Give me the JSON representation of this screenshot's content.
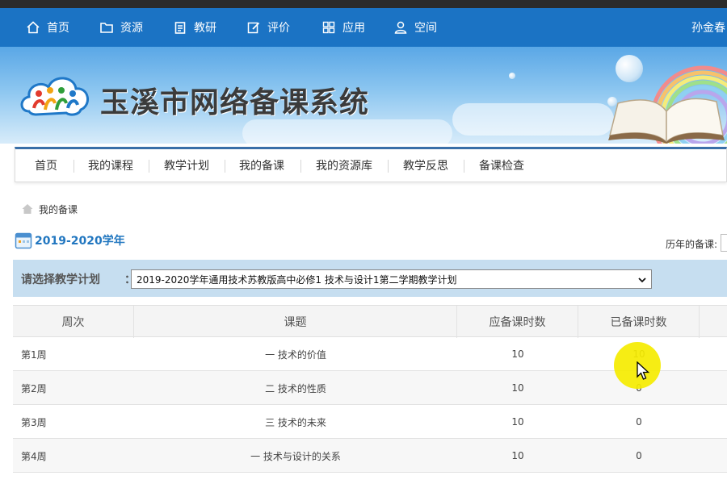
{
  "top_nav": {
    "items": [
      {
        "label": "首页",
        "icon": "home-icon"
      },
      {
        "label": "资源",
        "icon": "folder-icon"
      },
      {
        "label": "教研",
        "icon": "clipboard-icon"
      },
      {
        "label": "评价",
        "icon": "edit-icon"
      },
      {
        "label": "应用",
        "icon": "grid-icon"
      },
      {
        "label": "空间",
        "icon": "user-icon"
      }
    ],
    "user_name": "孙金春"
  },
  "banner": {
    "site_title": "玉溪市网络备课系统"
  },
  "sub_nav": {
    "items": [
      "首页",
      "我的课程",
      "教学计划",
      "我的备课",
      "我的资源库",
      "教学反思",
      "备课检查"
    ]
  },
  "breadcrumb": {
    "label": "我的备课"
  },
  "school_year": {
    "label": "2019-2020学年"
  },
  "history_label": "历年的备课:",
  "plan_select": {
    "label": "请选择教学计划",
    "colon": "：",
    "selected": "2019-2020学年通用技术苏教版高中必修1 技术与设计1第二学期教学计划"
  },
  "table": {
    "headers": [
      "周次",
      "课题",
      "应备课时数",
      "已备课时数"
    ],
    "rows": [
      {
        "week": "第1周",
        "topic": "一 技术的价值",
        "required": "10",
        "done": "10"
      },
      {
        "week": "第2周",
        "topic": "二 技术的性质",
        "required": "10",
        "done": "0"
      },
      {
        "week": "第3周",
        "topic": "三 技术的未来",
        "required": "10",
        "done": "0"
      },
      {
        "week": "第4周",
        "topic": "一 技术与设计的关系",
        "required": "10",
        "done": "0"
      }
    ]
  },
  "colors": {
    "top_nav_bg": "#1b73c4",
    "accent_blue": "#2277c0",
    "plan_bar_bg": "#c6def0",
    "highlight": "#f5eb00"
  }
}
